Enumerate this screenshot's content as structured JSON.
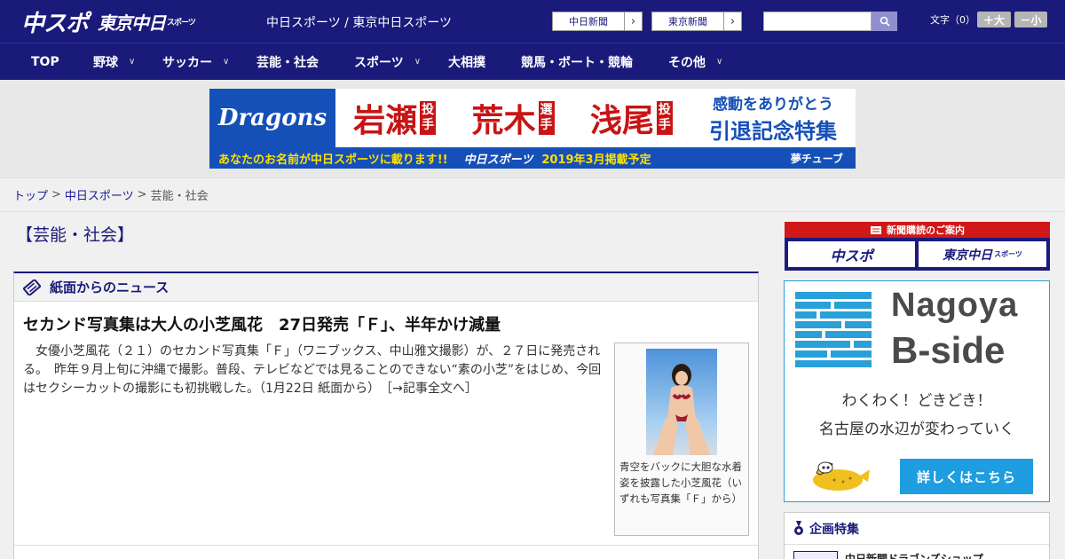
{
  "header": {
    "logo_chuspo": "中スポ",
    "logo_tokyo": "東京中日",
    "logo_tokyo_small": "スポーツ",
    "site_links": "中日スポーツ / 東京中日スポーツ",
    "paper_links": [
      {
        "label": "中日新聞"
      },
      {
        "label": "東京新聞"
      }
    ],
    "search_placeholder": "",
    "font_size_label": "文字（0）",
    "font_plus": "＋大",
    "font_minus": "－小"
  },
  "nav": {
    "items": [
      {
        "label": "TOP",
        "has_dropdown": false
      },
      {
        "label": "野球",
        "has_dropdown": true
      },
      {
        "label": "サッカー",
        "has_dropdown": true
      },
      {
        "label": "芸能・社会",
        "has_dropdown": false
      },
      {
        "label": "スポーツ",
        "has_dropdown": true
      },
      {
        "label": "大相撲",
        "has_dropdown": false
      },
      {
        "label": "競馬・ボート・競輪",
        "has_dropdown": false
      },
      {
        "label": "その他",
        "has_dropdown": true
      }
    ]
  },
  "ad_banner": {
    "team": "Dragons",
    "players": [
      {
        "name": "岩瀬",
        "pos": "投手"
      },
      {
        "name": "荒木",
        "pos": "選手"
      },
      {
        "name": "浅尾",
        "pos": "投手"
      }
    ],
    "right_line1": "感動をありがとう",
    "right_line2": "引退記念特集",
    "bottom_text": "あなたのお名前が中日スポーツに載ります!!",
    "bottom_logo": "中日スポーツ",
    "bottom_date": "2019年3月掲載予定",
    "bottom_sponsor": "夢チューブ"
  },
  "breadcrumb": {
    "items": [
      "トップ",
      "中日スポーツ",
      "芸能・社会"
    ],
    "separator": ">"
  },
  "category_title": "【芸能・社会】",
  "news_section": {
    "header": "紙面からのニュース",
    "article": {
      "title": "セカンド写真集は大人の小芝風花　27日発売「Ｆ」、半年かけ減量",
      "body": "　女優小芝風花（２１）のセカンド写真集「Ｆ」（ワニブックス、中山雅文撮影）が、２７日に発売される。　昨年９月上旬に沖縄で撮影。普段、テレビなどでは見ることのできない“素の小芝”をはじめ、今回はセクシーカットの撮影にも初挑戦した。（1月22日 紙面から）",
      "more_link": "［→記事全文へ］",
      "photo_caption": "青空をバックに大胆な水着姿を披露した小芝風花（いずれも写真集「Ｆ」から）"
    }
  },
  "sidebar": {
    "subscription": {
      "header": "新聞購読のご案内",
      "btn1": "中スポ",
      "btn2": "東京中日",
      "btn2_small": "スポーツ"
    },
    "nagoya_ad": {
      "title1": "Nagoya",
      "title2": "B-side",
      "line1": "わくわく！どきどき！",
      "line2": "名古屋の水辺が変わっていく",
      "button": "詳しくはこちら"
    },
    "kikaku": {
      "header": "企画特集",
      "item": "中日新聞ドラゴンズショップ"
    }
  },
  "colors": {
    "header_bg": "#1a1a7a",
    "accent_red": "#d01818",
    "ad_blue": "#1550b8",
    "nagoya_blue": "#2aa0d8"
  }
}
